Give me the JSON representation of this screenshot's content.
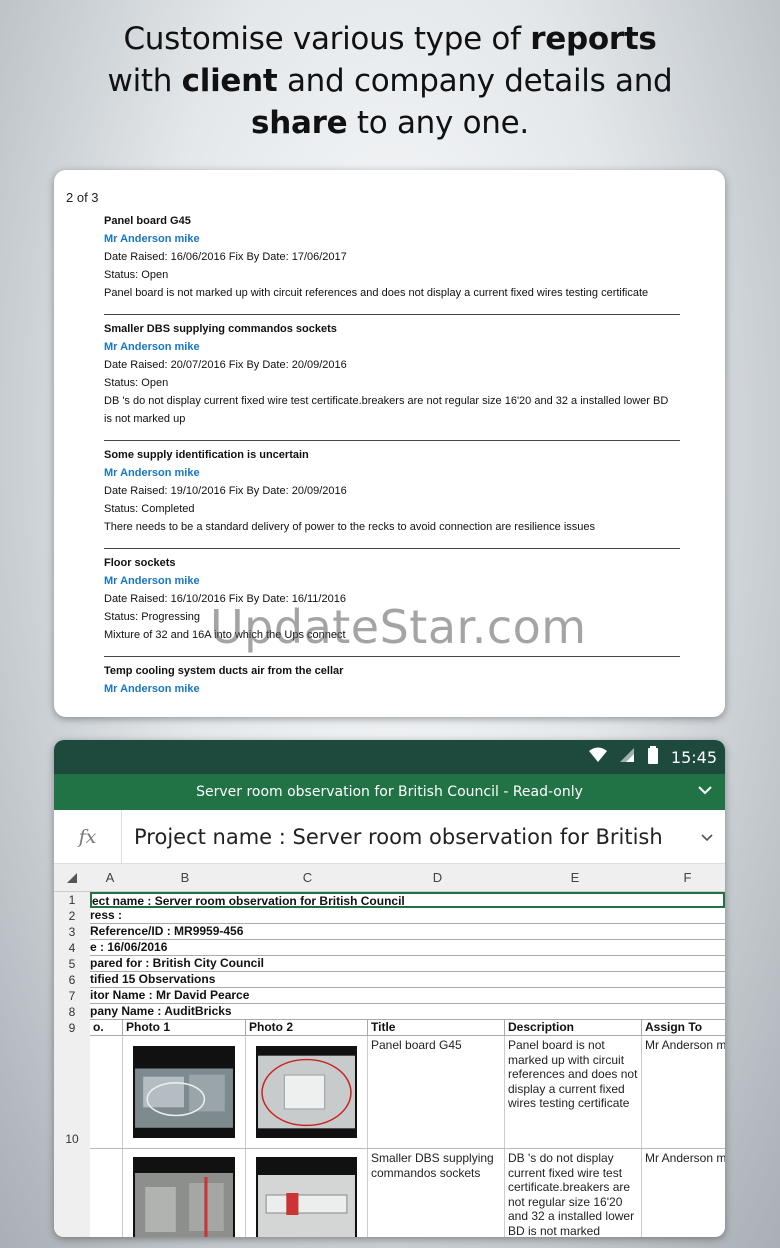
{
  "headline": {
    "line1_a": "Customise various type of ",
    "line1_b": "reports",
    "line2_a": "with ",
    "line2_b": "client",
    "line2_c": " and company details and",
    "line3_a": "share",
    "line3_b": " to any one."
  },
  "report": {
    "page_count": "2 of 3",
    "observations": [
      {
        "title": "Panel board G45",
        "assignee": "Mr Anderson mike",
        "dates": "Date Raised: 16/06/2016   Fix By Date: 17/06/2017",
        "status": "Status: Open",
        "description": "Panel board is not marked up with circuit references and does not display a current fixed wires testing certificate"
      },
      {
        "title": "Smaller DBS supplying commandos sockets",
        "assignee": "Mr Anderson mike",
        "dates": "Date Raised: 20/07/2016   Fix By Date: 20/09/2016",
        "status": "Status: Open",
        "description": "DB 's do not display current fixed wire test certificate.breakers are not   regular size  16'20 and 32 a installed lower BD is not marked up"
      },
      {
        "title": "Some supply identification is uncertain",
        "assignee": "Mr Anderson  mike",
        "dates": "Date Raised: 19/10/2016   Fix By Date: 20/09/2016",
        "status": "Status: Completed",
        "description": "There needs to be a standard delivery of power  to the recks to avoid  connection are resilience issues"
      },
      {
        "title": "Floor sockets",
        "assignee": "Mr Anderson  mike",
        "dates": "Date Raised: 16/10/2016   Fix By Date: 16/11/2016",
        "status": "Status: Progressing",
        "description": "Mixture  of 32 and 16A into which the Ups  connect"
      },
      {
        "title": "Temp cooling system ducts air from the  cellar",
        "assignee": "Mr Anderson mike",
        "dates": "",
        "status": "",
        "description": ""
      }
    ]
  },
  "watermark": "UpdateStar.com",
  "phone": {
    "time": "15:45",
    "window_title": "Server room observation for British Council - Read-only",
    "fx_label": "fx",
    "formula_value": "Project name : Server room observation for British",
    "columns": [
      "A",
      "B",
      "C",
      "D",
      "E",
      "F"
    ],
    "row_numbers": [
      "1",
      "2",
      "3",
      "4",
      "5",
      "6",
      "7",
      "8",
      "9",
      "10"
    ],
    "info_rows": [
      "ect name : Server room observation for British Council",
      "ress :",
      " Reference/ID : MR9959-456",
      "e : 16/06/2016",
      "pared for : British  City Council",
      "tified 15 Observations",
      "itor Name : Mr David Pearce",
      "pany Name : AuditBricks"
    ],
    "table_header": [
      "o.",
      "Photo 1",
      "Photo 2",
      "Title",
      "Description",
      "Assign To"
    ],
    "table_rows": [
      {
        "title": "Panel board G45",
        "description": "Panel board is not marked up with circuit references and does not display a current fixed wires testing certificate",
        "assign": "Mr Anderson m"
      },
      {
        "title": "Smaller DBS supplying commandos sockets",
        "description": "DB 's do not display current fixed wire test certificate.breakers are not   regular size  16'20 and 32 a installed lower BD is not marked",
        "assign": "Mr Anderson m"
      }
    ]
  },
  "colors": {
    "accent_green": "#217346",
    "status_bar": "#1d4a3c",
    "assignee_blue": "#1976c6"
  }
}
